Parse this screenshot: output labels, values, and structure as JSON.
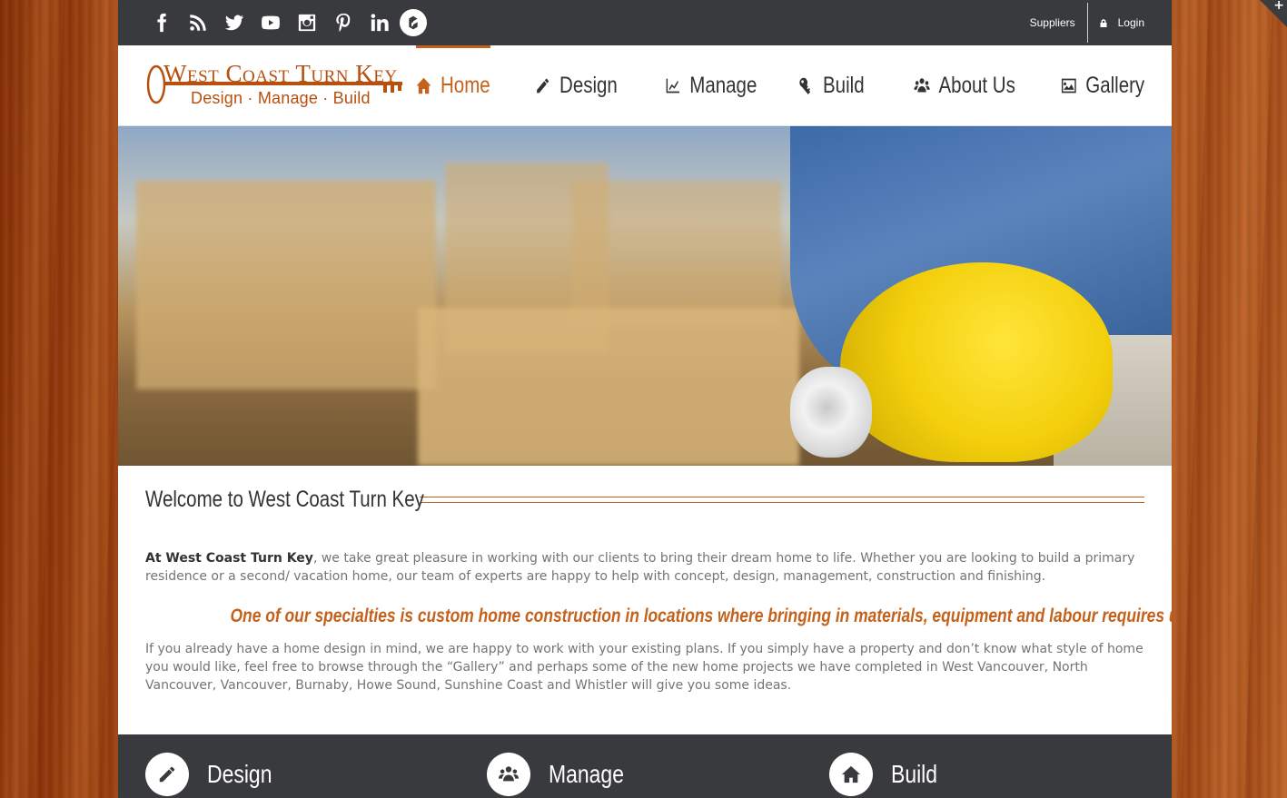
{
  "topbar": {
    "social_icons": [
      "facebook-icon",
      "rss-icon",
      "twitter-icon",
      "youtube-icon",
      "instagram-icon",
      "pinterest-icon",
      "linkedin-icon",
      "houzz-icon"
    ],
    "links": {
      "suppliers": "Suppliers",
      "login": "Login"
    }
  },
  "logo": {
    "line1": "West Coast Turn Key",
    "line2": "Design · Manage · Build"
  },
  "nav": {
    "items": [
      {
        "label": "Home",
        "icon": "home-icon",
        "active": true
      },
      {
        "label": "Design",
        "icon": "pencil-icon"
      },
      {
        "label": "Manage",
        "icon": "line-chart-icon"
      },
      {
        "label": "Build",
        "icon": "wrench-icon"
      },
      {
        "label": "About Us",
        "icon": "users-icon"
      },
      {
        "label": "Gallery",
        "icon": "image-icon"
      }
    ]
  },
  "main": {
    "welcome_title": "Welcome to West Coast Turn Key",
    "intro_bold": "At West Coast Turn Key",
    "intro_rest": ", we take great pleasure in working with our clients to bring their dream home to life. Whether you are looking to build a primary residence or a second/ vacation home, our team of experts are happy to help with concept, design, management, construction and finishing.",
    "highlight": "One of our specialties is custom home construction in locations where bringing in materials, equipment and labour requires unique logistics.",
    "para2": "If you already have a home design in mind, we are happy to work with your existing plans. If you simply have a property and don’t know what style of home you would like, feel free to browse through the “Gallery” and perhaps some of the new home projects we have completed in West Vancouver, North Vancouver, Vancouver, Burnaby, Howe Sound, Sunshine Coast and Whistler will give you some ideas."
  },
  "features": [
    {
      "title": "Design",
      "icon": "pencil-icon"
    },
    {
      "title": "Manage",
      "icon": "users-icon"
    },
    {
      "title": "Build",
      "icon": "home-icon"
    }
  ],
  "colors": {
    "accent": "#c4621b",
    "topbar": "#393a3d",
    "logo": "#b84f0d"
  }
}
